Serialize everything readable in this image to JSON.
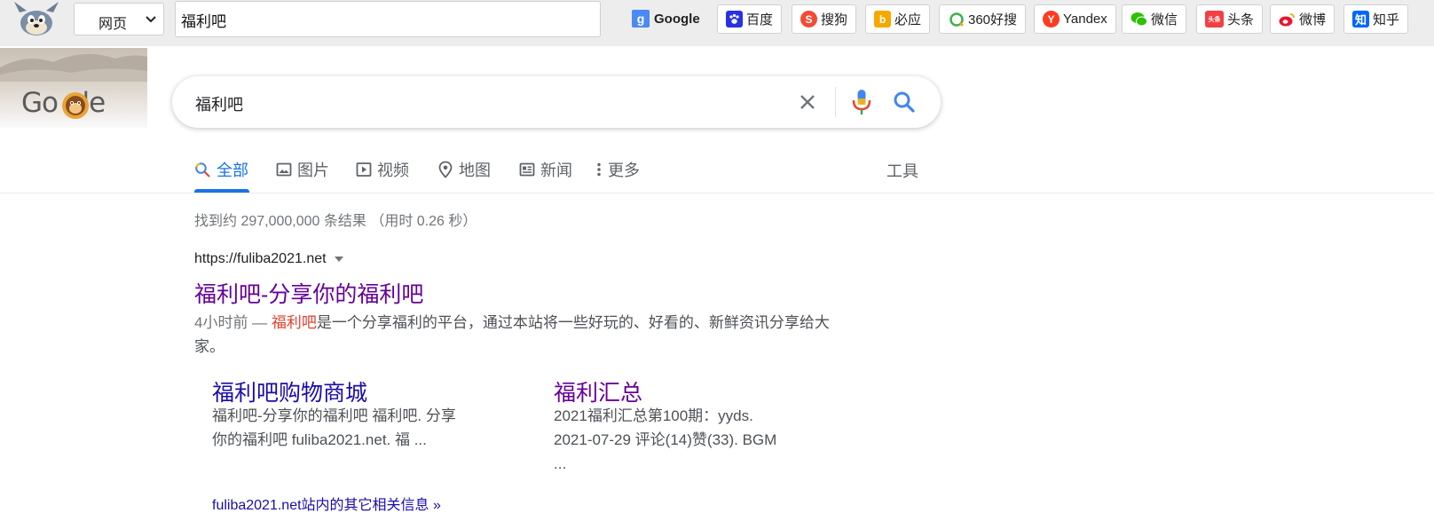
{
  "toolbar": {
    "engine_select": "网页",
    "query": "福利吧",
    "google_label": "Google",
    "engines": [
      {
        "label": "百度",
        "icon": "baidu-paw-icon",
        "color": "#2932e1"
      },
      {
        "label": "搜狗",
        "icon": "sogou-icon",
        "color": "#f44b35"
      },
      {
        "label": "必应",
        "icon": "bing-icon",
        "color": "#f7a800"
      },
      {
        "label": "360好搜",
        "icon": "360-icon",
        "color": "#3cb34a"
      },
      {
        "label": "Yandex",
        "icon": "yandex-icon",
        "color": "#ff3b1f"
      },
      {
        "label": "微信",
        "icon": "wechat-icon",
        "color": "#2dc100"
      },
      {
        "label": "头条",
        "icon": "toutiao-icon",
        "color": "#f04142"
      },
      {
        "label": "微博",
        "icon": "weibo-icon",
        "color": "#e6162d"
      },
      {
        "label": "知乎",
        "icon": "zhihu-icon",
        "color": "#0066ff"
      }
    ],
    "zhihu_glyph": "知",
    "toutiao_glyph": "头条"
  },
  "header": {
    "logo_text": "Go  gle",
    "search_query": "福利吧"
  },
  "tabs": [
    {
      "label": "全部",
      "icon": "search-icon",
      "active": true
    },
    {
      "label": "图片",
      "icon": "image-icon"
    },
    {
      "label": "视频",
      "icon": "video-icon"
    },
    {
      "label": "地图",
      "icon": "map-pin-icon"
    },
    {
      "label": "新闻",
      "icon": "news-icon"
    },
    {
      "label": "更多",
      "icon": "more-vert-icon"
    }
  ],
  "tools_label": "工具",
  "stats": "找到约 297,000,000 条结果 （用时 0.26 秒）",
  "result": {
    "url": "https://fuliba2021.net",
    "title": "福利吧-分享你的福利吧",
    "date": "4小时前 —",
    "highlight": "福利吧",
    "snippet_rest": "是一个分享福利的平台，通过本站将一些好玩的、好看的、新鲜资讯分享给大家。",
    "sitelinks": [
      {
        "title": "福利吧购物商城",
        "snippet": "福利吧-分享你的福利吧 福利吧. 分享你的福利吧 fuliba2021.net. 福 ..."
      },
      {
        "title": "福利汇总",
        "snippet": "2021福利汇总第100期：yyds. 2021-07-29 评论(14)赞(33). BGM ..."
      }
    ],
    "more_link": "fuliba2021.net站内的其它相关信息 »"
  },
  "colors": {
    "link_blue": "#1a0dab",
    "visited_purple": "#660099",
    "active_tab": "#1a73e8",
    "highlight_red": "#e33e2b"
  }
}
